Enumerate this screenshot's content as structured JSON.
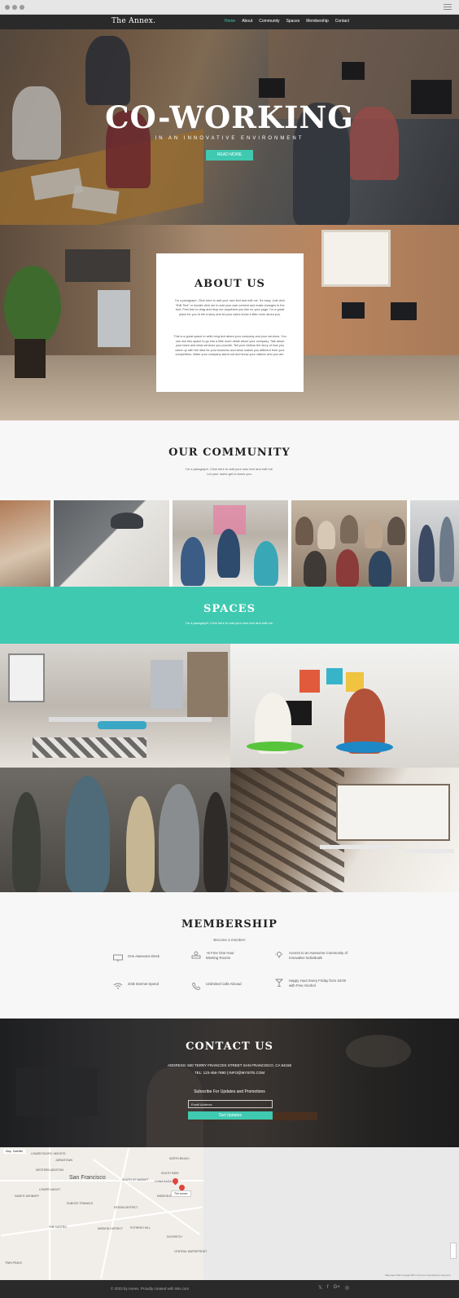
{
  "site": {
    "brand": "The Annex."
  },
  "nav": [
    {
      "label": "Home"
    },
    {
      "label": "About"
    },
    {
      "label": "Community"
    },
    {
      "label": "Spaces"
    },
    {
      "label": "Membership"
    },
    {
      "label": "Contact"
    }
  ],
  "colors": {
    "accent": "#40c9b1",
    "dark": "#2a2a2a",
    "light": "#f7f7f7"
  },
  "hero": {
    "title": "CO-WORKING",
    "subtitle": "IN AN INNOVATIVE ENVIRONMENT",
    "button": "READ MORE"
  },
  "about": {
    "title": "ABOUT US",
    "p1": "I'm a paragraph. Click here to add your own text and edit me. It's easy. Just click \"Edit Text\" or double click me to add your own content and make changes to the font. Feel free to drag and drop me anywhere you like on your page. I'm a great place for you to tell a story and let your users know a little more about you.",
    "p2": "This is a great space to write long text about your company and your services. You can use this space to go into a little more detail about your company. Talk about your team and what services you provide. Tell your visitors the story of how you came up with the idea for your business and what makes you different from your competitors. Make your company stand out and show your visitors who you are."
  },
  "community": {
    "title": "OUR COMMUNITY",
    "text1": "I'm a paragraph. Click here to add your own text and edit me.",
    "text2": "Let your users get to know you."
  },
  "spaces": {
    "title": "SPACES",
    "text": "I'm a paragraph. Click here to add your own text and edit me."
  },
  "membership": {
    "title": "MEMBERSHIP",
    "subtitle": "Become a member!",
    "features": [
      {
        "icon": "desk-icon",
        "line1": "One Awesome Desk",
        "line2": ""
      },
      {
        "icon": "meeting-icon",
        "line1": "+5 Free One Hour",
        "line2": "Meeting Rooms"
      },
      {
        "icon": "lightbulb-icon",
        "line1": "Access to an Awesome Community of",
        "line2": "Innovative Individuals"
      },
      {
        "icon": "wifi-icon",
        "line1": "2GB Internet Speed",
        "line2": ""
      },
      {
        "icon": "phone-icon",
        "line1": "Unlimited Calls Abroad",
        "line2": ""
      },
      {
        "icon": "cocktail-icon",
        "line1": "Happy Hour Every Friday from 18:00",
        "line2": "with Free Alcohol"
      }
    ]
  },
  "contact": {
    "title": "CONTACT US",
    "address": "ADDRESS: 500 TERRY FRANCOIS STREET SAN FRANCISCO, CA 94158",
    "phone_email": "TEL: 123-456-7890  |  INFO@MYSITE.COM",
    "subscribe": "Subscribe For Updates and Promotions",
    "email_placeholder": "Email Address",
    "button": "Get Updates"
  },
  "map": {
    "mode_map": "Map",
    "mode_sat": "Satellite",
    "city": "San Francisco",
    "tag": "The annex",
    "labels": [
      "LOWER PACIFIC HEIGHTS",
      "JAPANTOWN",
      "WESTERN ADDITION",
      "NORTH BEACH",
      "SOUTH PARK",
      "CHINA BASIN",
      "MISSION BAY",
      "DOGPATCH",
      "POTRERO HILL",
      "MISSION DISTRICT",
      "THE CASTRO",
      "HAIGHT-ASHBURY",
      "LOWER HAIGHT",
      "TWIN PEAKS",
      "DUBOCE TRIANGLE",
      "DESIGN DISTRICT",
      "CENTRAL WATERFRONT",
      "SOUTH OF MARKET"
    ],
    "footer": "Map data ©2017 Google   500 m   Terms of Use   Report a map error"
  },
  "footer": {
    "copyright": "© 2023 by Annex. Proudly created with Wix.com",
    "socials": [
      "twitter-icon",
      "facebook-icon",
      "google-plus-icon",
      "instagram-icon"
    ],
    "social_glyphs": [
      "𝕏",
      "f",
      "G+",
      "◎"
    ]
  }
}
